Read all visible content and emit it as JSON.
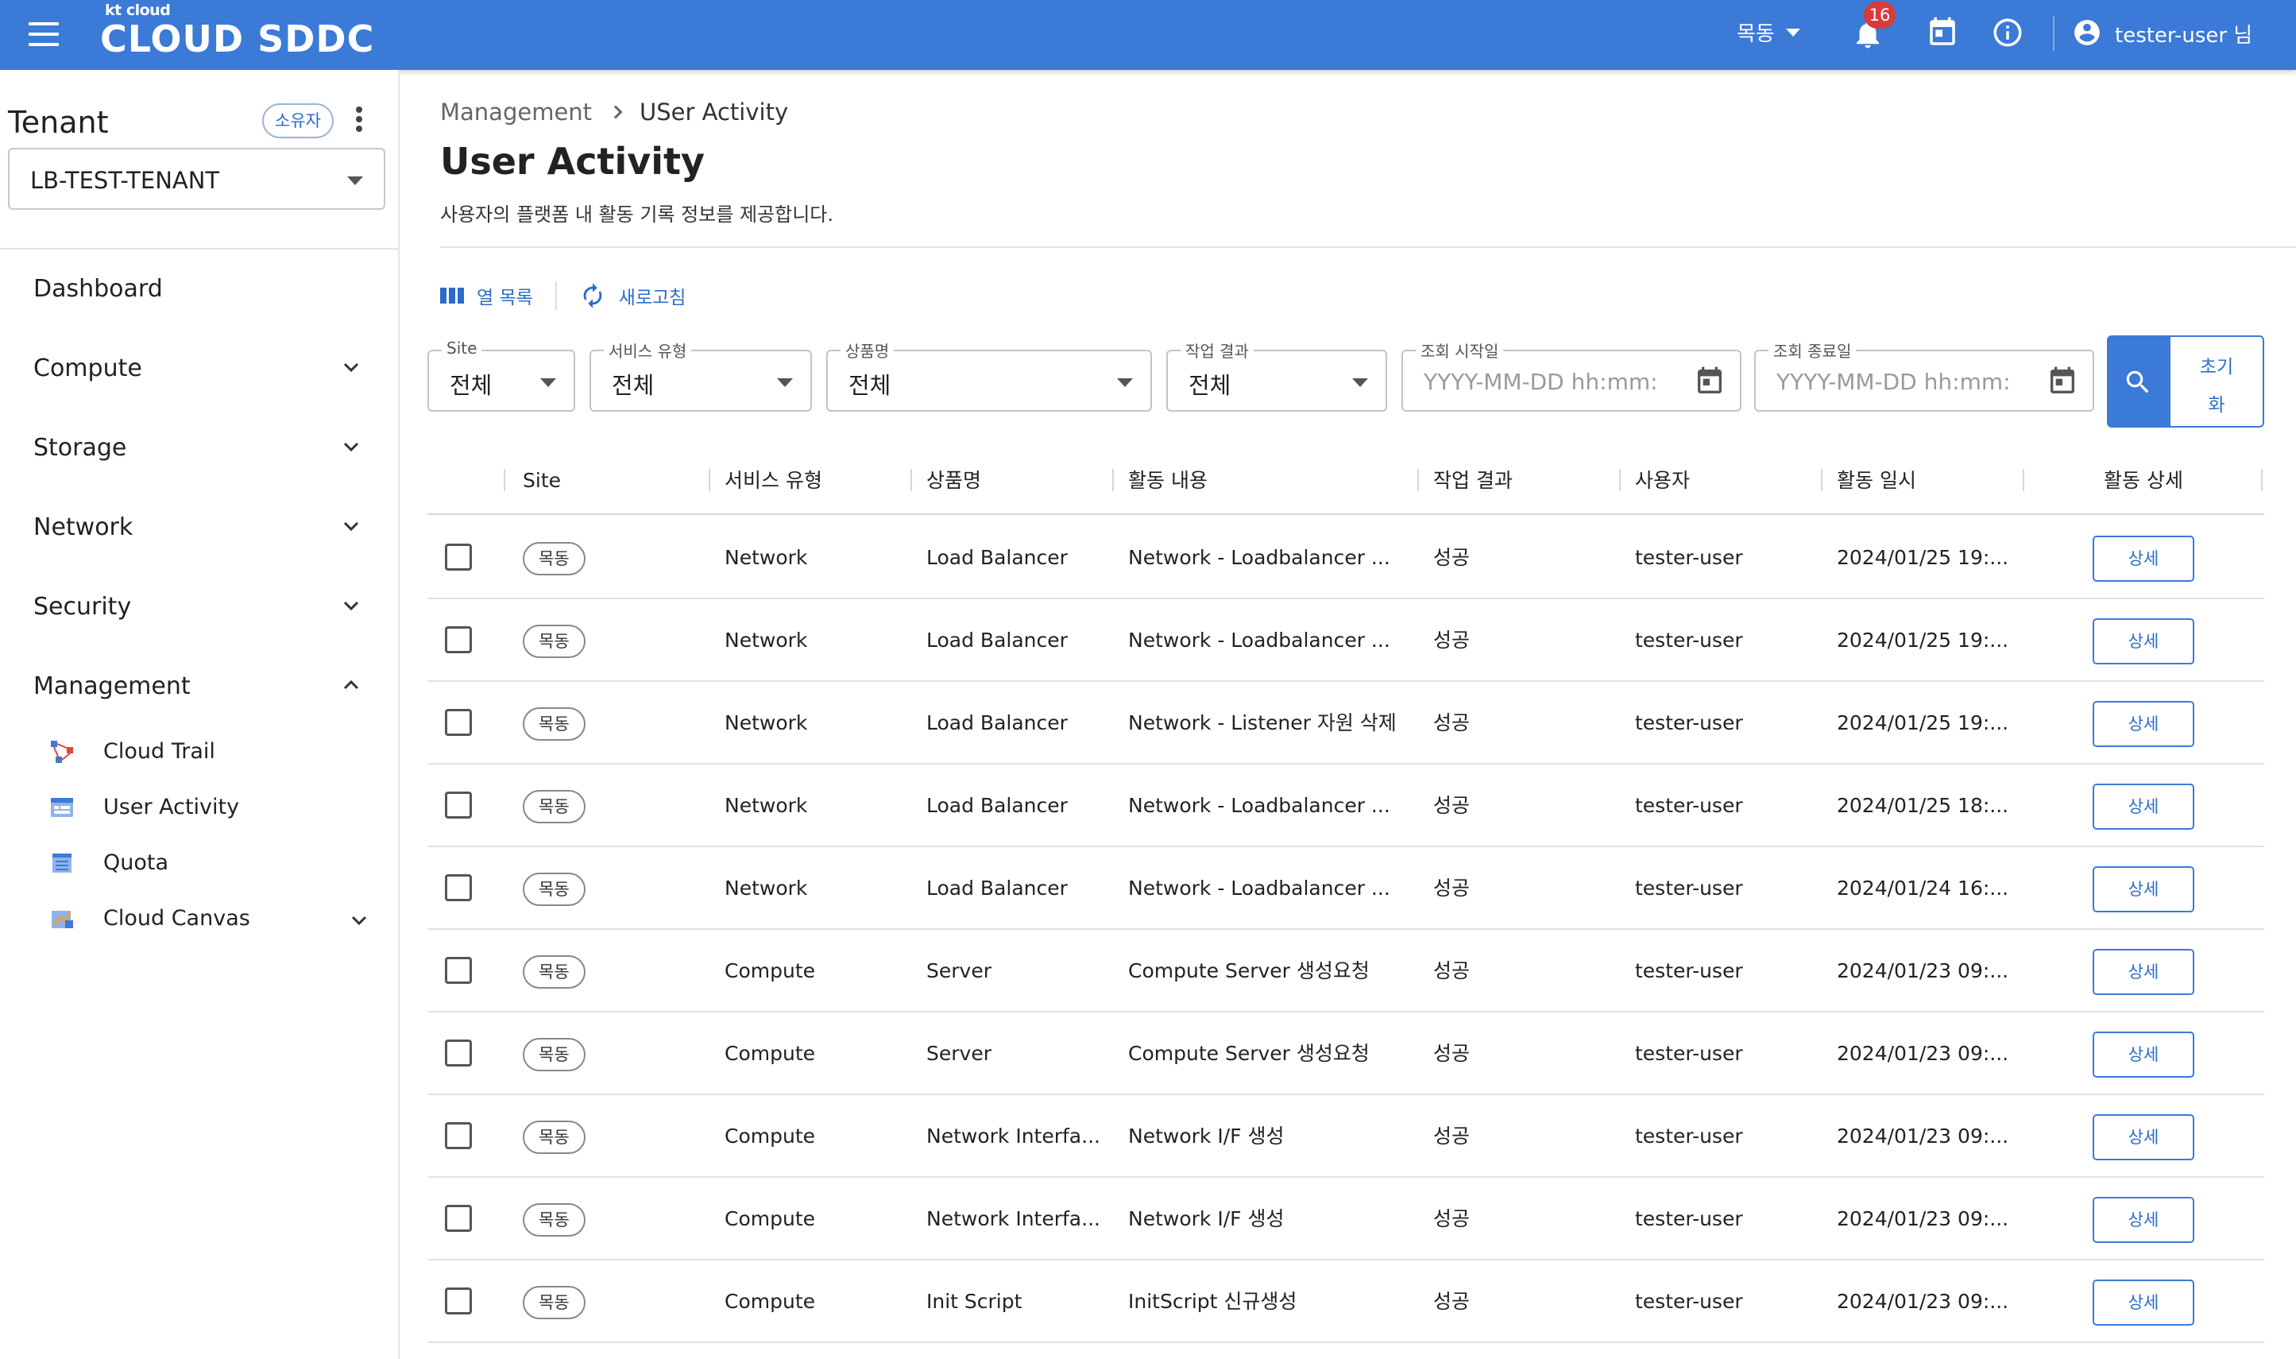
{
  "header": {
    "logo_small": "kt cloud",
    "logo_main": "CLOUD SDDC",
    "site_selector": "목동",
    "notification_count": "16",
    "user_label": "tester-user 님"
  },
  "sidebar": {
    "tenant_title": "Tenant",
    "owner_badge": "소유자",
    "tenant_value": "LB-TEST-TENANT",
    "nav": {
      "dashboard": "Dashboard",
      "compute": "Compute",
      "storage": "Storage",
      "network": "Network",
      "security": "Security",
      "management": "Management"
    },
    "management_items": {
      "cloud_trail": "Cloud Trail",
      "user_activity": "User Activity",
      "quota": "Quota",
      "cloud_canvas": "Cloud Canvas"
    }
  },
  "breadcrumb": {
    "parent": "Management",
    "current": "USer Activity"
  },
  "page": {
    "title": "User Activity",
    "description": "사용자의 플랫폼 내 활동 기록 정보를 제공합니다."
  },
  "toolbar": {
    "columns_label": "열 목록",
    "refresh_label": "새로고침"
  },
  "filters": {
    "site": {
      "label": "Site",
      "value": "전체"
    },
    "service_type": {
      "label": "서비스 유형",
      "value": "전체"
    },
    "product": {
      "label": "상품명",
      "value": "전체"
    },
    "result": {
      "label": "작업 결과",
      "value": "전체"
    },
    "start_date": {
      "label": "조회 시작일",
      "placeholder": "YYYY-MM-DD hh:mm:"
    },
    "end_date": {
      "label": "조회 종료일",
      "placeholder": "YYYY-MM-DD hh:mm:"
    },
    "reset_label_1": "초기",
    "reset_label_2": "화"
  },
  "table": {
    "headers": {
      "site": "Site",
      "service_type": "서비스 유형",
      "product": "상품명",
      "activity": "활동 내용",
      "result": "작업 결과",
      "user": "사용자",
      "datetime": "활동 일시",
      "detail": "활동 상세"
    },
    "detail_label": "상세",
    "rows": [
      {
        "site": "목동",
        "service_type": "Network",
        "product": "Load Balancer",
        "activity": "Network - Loadbalancer ...",
        "result": "성공",
        "user": "tester-user",
        "datetime": "2024/01/25 19:..."
      },
      {
        "site": "목동",
        "service_type": "Network",
        "product": "Load Balancer",
        "activity": "Network - Loadbalancer ...",
        "result": "성공",
        "user": "tester-user",
        "datetime": "2024/01/25 19:..."
      },
      {
        "site": "목동",
        "service_type": "Network",
        "product": "Load Balancer",
        "activity": "Network - Listener 자원 삭제",
        "result": "성공",
        "user": "tester-user",
        "datetime": "2024/01/25 19:..."
      },
      {
        "site": "목동",
        "service_type": "Network",
        "product": "Load Balancer",
        "activity": "Network - Loadbalancer ...",
        "result": "성공",
        "user": "tester-user",
        "datetime": "2024/01/25 18:..."
      },
      {
        "site": "목동",
        "service_type": "Network",
        "product": "Load Balancer",
        "activity": "Network - Loadbalancer ...",
        "result": "성공",
        "user": "tester-user",
        "datetime": "2024/01/24 16:..."
      },
      {
        "site": "목동",
        "service_type": "Compute",
        "product": "Server",
        "activity": "Compute Server 생성요청",
        "result": "성공",
        "user": "tester-user",
        "datetime": "2024/01/23 09:..."
      },
      {
        "site": "목동",
        "service_type": "Compute",
        "product": "Server",
        "activity": "Compute Server 생성요청",
        "result": "성공",
        "user": "tester-user",
        "datetime": "2024/01/23 09:..."
      },
      {
        "site": "목동",
        "service_type": "Compute",
        "product": "Network Interfa...",
        "activity": "Network I/F 생성",
        "result": "성공",
        "user": "tester-user",
        "datetime": "2024/01/23 09:..."
      },
      {
        "site": "목동",
        "service_type": "Compute",
        "product": "Network Interfa...",
        "activity": "Network I/F 생성",
        "result": "성공",
        "user": "tester-user",
        "datetime": "2024/01/23 09:..."
      },
      {
        "site": "목동",
        "service_type": "Compute",
        "product": "Init Script",
        "activity": "InitScript 신규생성",
        "result": "성공",
        "user": "tester-user",
        "datetime": "2024/01/23 09:..."
      }
    ]
  },
  "colors": {
    "primary": "#3b7ad6",
    "link": "#2b6cc9",
    "badge": "#d93a3a"
  }
}
